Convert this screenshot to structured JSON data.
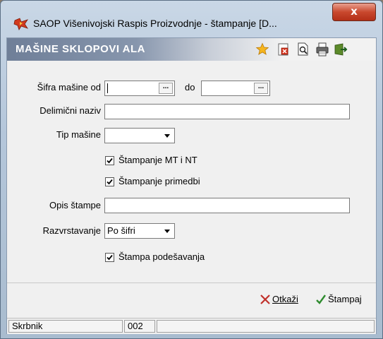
{
  "window": {
    "title": "SAOP Višenivojski Raspis Proizvodnje - štampanje [D...",
    "close_label": "x"
  },
  "header": {
    "title": "MAŠINE SKLOPOVI ALA",
    "icons": [
      "star-icon",
      "delete-icon",
      "preview-icon",
      "printer-icon",
      "exit-icon"
    ]
  },
  "form": {
    "sifra_od_label": "Šifra mašine od",
    "sifra_od_value": "",
    "do_label": "do",
    "sifra_do_value": "",
    "dots_label": "...",
    "delimicni_label": "Delimični naziv",
    "delimicni_value": "",
    "tip_label": "Tip mašine",
    "tip_value": "",
    "stampanje_mt_label": "Štampanje MT i NT",
    "stampanje_mt_checked": true,
    "stampanje_primedbi_label": "Štampanje primedbi",
    "stampanje_primedbi_checked": true,
    "opis_label": "Opis štampe",
    "opis_value": "",
    "razvrstavanje_label": "Razvrstavanje",
    "razvrstavanje_value": "Po šifri",
    "stampa_podesavanja_label": "Štampa podešavanja",
    "stampa_podesavanja_checked": true
  },
  "actions": {
    "cancel_label": "Otkaži",
    "print_label": "Štampaj"
  },
  "status": {
    "user": "Skrbnik",
    "code": "002",
    "extra": ""
  },
  "colors": {
    "header_gradient_start": "#6f7f98",
    "close_red": "#c9482e",
    "cancel_x": "#c0302a",
    "print_check": "#2e8b2e"
  }
}
